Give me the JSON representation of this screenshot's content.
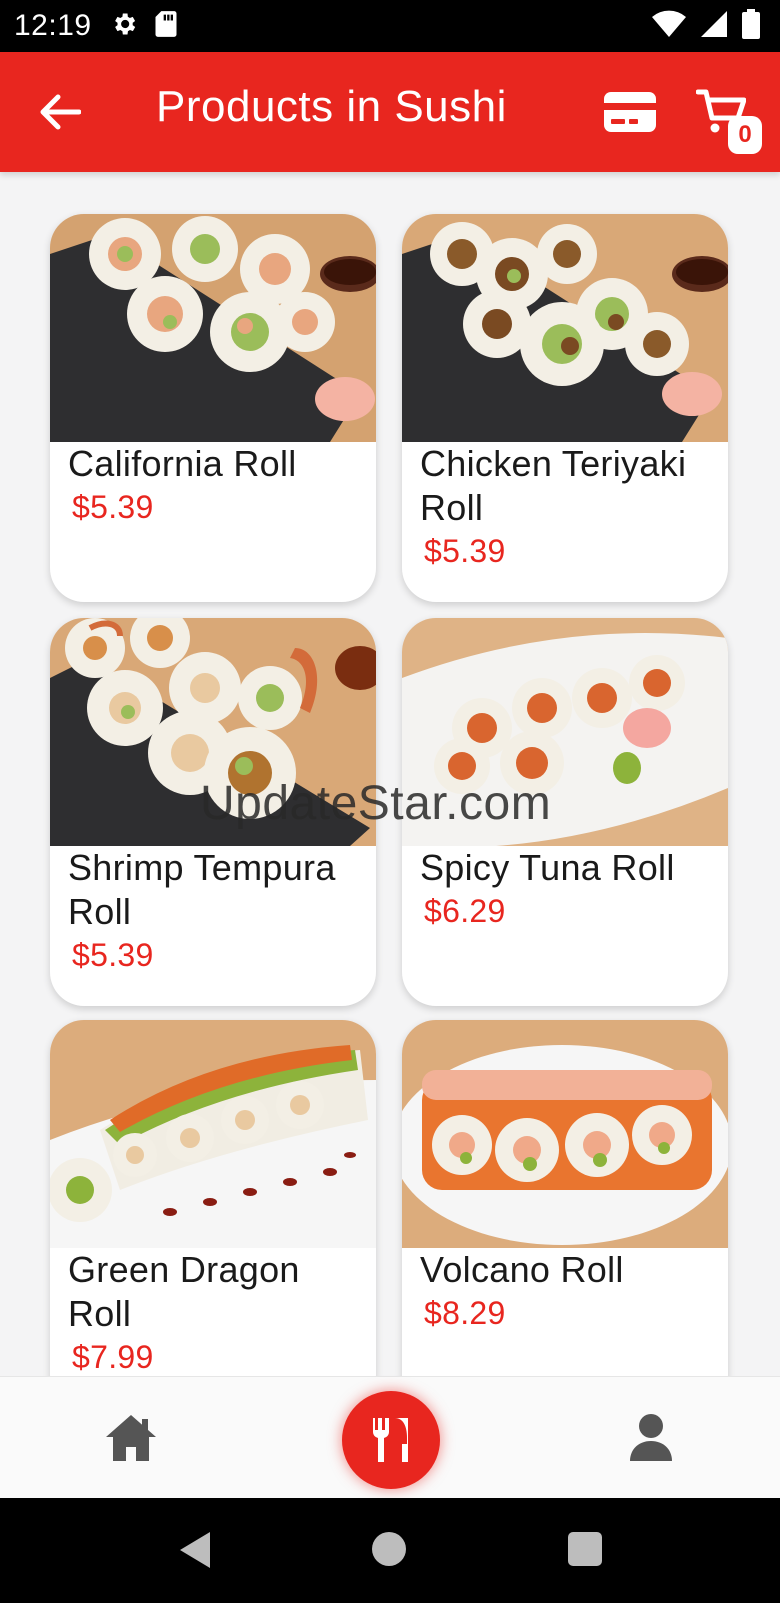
{
  "status_bar": {
    "time": "12:19"
  },
  "app_bar": {
    "title": "Products in Sushi",
    "cart_count": "0"
  },
  "products": [
    {
      "name": "California Roll",
      "price": "$5.39"
    },
    {
      "name": "Chicken Teriyaki Roll",
      "price": "$5.39"
    },
    {
      "name": "Shrimp Tempura Roll",
      "price": "$5.39"
    },
    {
      "name": "Spicy Tuna Roll",
      "price": "$6.29"
    },
    {
      "name": "Green Dragon Roll",
      "price": "$7.99"
    },
    {
      "name": "Volcano Roll",
      "price": "$8.29"
    }
  ],
  "watermark": "UpdateStar.com",
  "bottom_nav": {
    "items": [
      "home-icon",
      "utensils-icon",
      "user-icon"
    ]
  },
  "colors": {
    "accent": "#e8261f",
    "background": "#f4f4f5"
  }
}
